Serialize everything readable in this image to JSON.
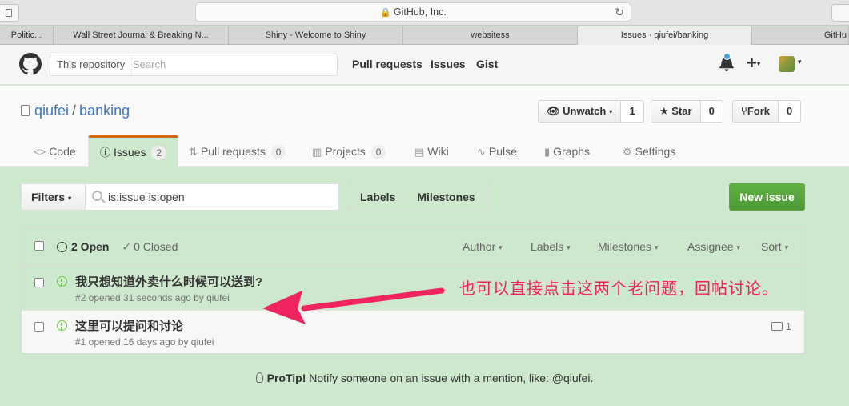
{
  "browser": {
    "address": "GitHub, Inc.",
    "tabs": [
      {
        "label": "Politic..."
      },
      {
        "label": "Wall Street Journal & Breaking N..."
      },
      {
        "label": "Shiny - Welcome to Shiny"
      },
      {
        "label": "websitess"
      },
      {
        "label": "Issues · qiufei/banking"
      },
      {
        "label": "GitHu"
      }
    ]
  },
  "header": {
    "scope_label": "This repository",
    "search_placeholder": "Search",
    "nav": [
      "Pull requests",
      "Issues",
      "Gist"
    ],
    "plus": "+"
  },
  "repo": {
    "owner": "qiufei",
    "separator": "/",
    "name": "banking",
    "watch_label": "Unwatch",
    "watch_count": "1",
    "star_label": "Star",
    "star_count": "0",
    "fork_label": "Fork",
    "fork_count": "0"
  },
  "reponav": {
    "code": "Code",
    "issues": "Issues",
    "issues_count": "2",
    "pulls": "Pull requests",
    "pulls_count": "0",
    "projects": "Projects",
    "projects_count": "0",
    "wiki": "Wiki",
    "pulse": "Pulse",
    "graphs": "Graphs",
    "settings": "Settings"
  },
  "subnav": {
    "filters": "Filters",
    "query": "is:issue is:open",
    "labels": "Labels",
    "milestones": "Milestones",
    "new_issue": "New issue"
  },
  "issues_header": {
    "open": "2 Open",
    "closed": "0 Closed",
    "author": "Author",
    "labels": "Labels",
    "milestones": "Milestones",
    "assignee": "Assignee",
    "sort": "Sort"
  },
  "issues": [
    {
      "title": "我只想知道外卖什么时候可以送到?",
      "meta": "#2 opened 31 seconds ago by qiufei",
      "comments": ""
    },
    {
      "title": "这里可以提问和讨论",
      "meta": "#1 opened 16 days ago by qiufei",
      "comments": "1"
    }
  ],
  "annotation": "也可以直接点击这两个老问题，回帖讨论。",
  "protip": {
    "label": "ProTip!",
    "text": " Notify someone on an issue with a mention, like: @qiufei."
  },
  "colors": {
    "accent_link": "#4078c0",
    "new_issue_green": "#60b044",
    "open_issue_green": "#6cc644",
    "annotation_pink": "#f0255f",
    "selected_tab_orange": "#d26911"
  }
}
